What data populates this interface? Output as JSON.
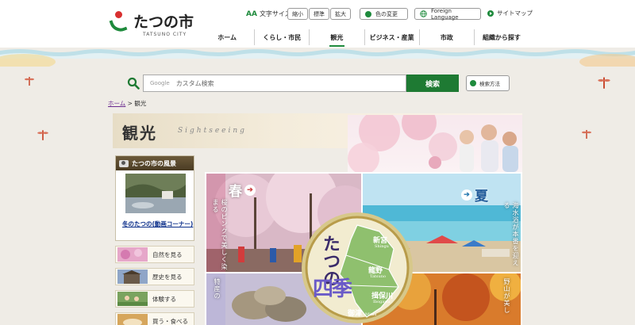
{
  "site": {
    "logo_text": "たつの市",
    "logo_sub": "TATSUNO CITY"
  },
  "utility": {
    "fontsize_icon": "AA",
    "fontsize_label": "文字サイズ",
    "fontsize_small": "縮小",
    "fontsize_normal": "標準",
    "fontsize_large": "拡大",
    "color_change": "色の変更",
    "foreign_language": "Foreign Language",
    "sitemap": "サイトマップ"
  },
  "gnav": [
    {
      "label": "ホーム"
    },
    {
      "label": "くらし・市民"
    },
    {
      "label": "観光"
    },
    {
      "label": "ビジネス・産業"
    },
    {
      "label": "市政"
    },
    {
      "label": "組織から探す"
    }
  ],
  "search": {
    "google_label": "Google",
    "placeholder": "カスタム検索",
    "button": "検索",
    "help": "検索方法"
  },
  "breadcrumb": {
    "home": "ホーム",
    "sep": ">",
    "current": "観光"
  },
  "page_title": {
    "jp": "観光",
    "en": "Sightseeing"
  },
  "sidebar": {
    "scenery_title": "たつの市の風景",
    "scenery_link": "冬のたつの(動画コーナー)",
    "menu": [
      {
        "label": "自然を見る"
      },
      {
        "label": "歴史を見る"
      },
      {
        "label": "体験する"
      },
      {
        "label": "買う・食べる"
      }
    ]
  },
  "seasons": {
    "spring": {
      "title": "春",
      "caption": "桜のピンクで美しく染まる"
    },
    "summer": {
      "title": "夏",
      "caption": "海水浴が本番を迎える"
    },
    "autumn_left_caption": "特産の",
    "autumn_right_caption": "野山が美し"
  },
  "medallion": {
    "title_top": "たつの",
    "title_bottom": "四季",
    "places": [
      {
        "jp": "新宮",
        "en": "Shingu"
      },
      {
        "jp": "龍野",
        "en": "Tatsuno"
      },
      {
        "jp": "揖保川",
        "en": "Ibogawa"
      },
      {
        "jp": "御津",
        "en": "Mitsu"
      }
    ]
  },
  "colors": {
    "brand_green": "#1e7a33",
    "logo_red": "#d82f2f",
    "link_blue": "#0b2e8a",
    "link_purple": "#6a2b8f"
  },
  "icons": {
    "search": "search-icon",
    "camera": "camera-icon",
    "globe": "globe-icon"
  }
}
